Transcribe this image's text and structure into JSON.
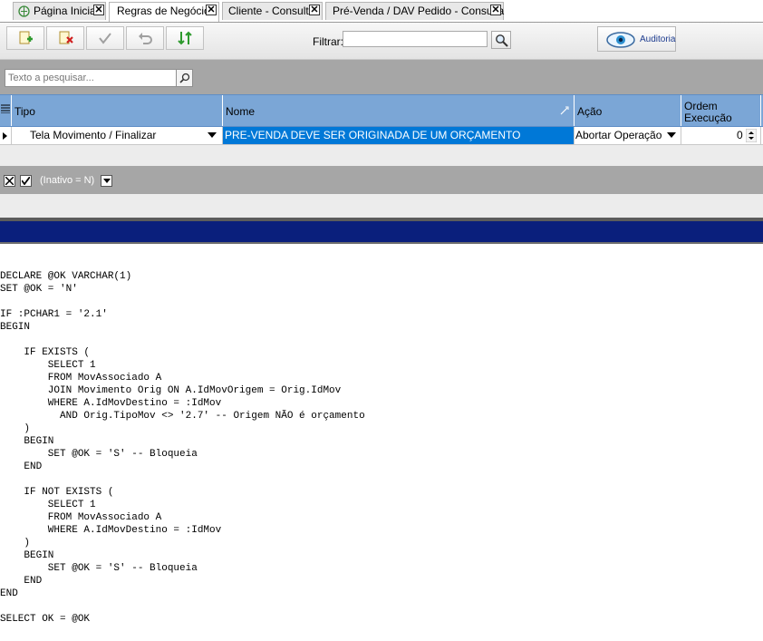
{
  "tabs": [
    {
      "label": "Página Inicial",
      "active": false,
      "icon": "home-globe-icon"
    },
    {
      "label": "Regras de Negócio",
      "active": true
    },
    {
      "label": "Cliente - Consulta",
      "active": false
    },
    {
      "label": "Pré-Venda / DAV Pedido - Consulta",
      "active": false
    }
  ],
  "toolbar": {
    "icons": [
      "new-record-icon",
      "delete-record-icon",
      "confirm-icon",
      "undo-icon",
      "sort-icon"
    ],
    "filter_label": "Filtrar:",
    "filter_value": "",
    "audit_label": "Auditoria"
  },
  "search": {
    "placeholder": "Texto a pesquisar..."
  },
  "grid": {
    "columns": [
      "Tipo",
      "Nome",
      "Ação",
      "Ordem Execução"
    ],
    "column_lines": {
      "ordem_1": "Ordem",
      "ordem_2": "Execução"
    },
    "rows": [
      {
        "tipo": "Tela Movimento / Finalizar",
        "nome": "PRE-VENDA DEVE SER ORIGINADA DE UM ORÇAMENTO",
        "acao": "Abortar Operação",
        "ordem": "0"
      }
    ]
  },
  "filter_bar": {
    "text": "(Inativo = N)"
  },
  "code": "DECLARE @OK VARCHAR(1)\nSET @OK = 'N'\n\nIF :PCHAR1 = '2.1'\nBEGIN\n\n    IF EXISTS (\n        SELECT 1\n        FROM MovAssociado A\n        JOIN Movimento Orig ON A.IdMovOrigem = Orig.IdMov\n        WHERE A.IdMovDestino = :IdMov\n          AND Orig.TipoMov <> '2.7' -- Origem NÃO é orçamento\n    )\n    BEGIN\n        SET @OK = 'S' -- Bloqueia\n    END\n\n    IF NOT EXISTS (\n        SELECT 1\n        FROM MovAssociado A\n        WHERE A.IdMovDestino = :IdMov\n    )\n    BEGIN\n        SET @OK = 'S' -- Bloqueia\n    END\nEND\n\nSELECT OK = @OK",
  "colors": {
    "header_blue": "#7ba6d6",
    "selected_cell": "#0078d7",
    "title_band": "#0a1f7c",
    "gray_strip": "#a6a6a6"
  }
}
